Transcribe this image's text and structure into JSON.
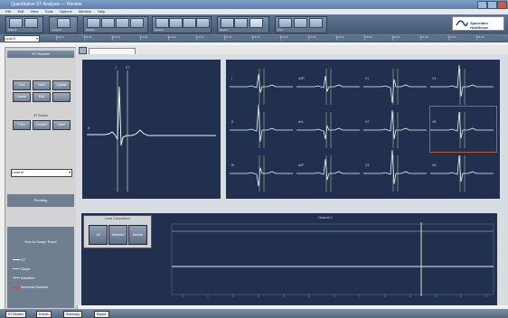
{
  "window": {
    "title": "Quantitative ST Analysis — Review"
  },
  "menu": [
    "File",
    "Edit",
    "View",
    "Tools",
    "Options",
    "Window",
    "Help"
  ],
  "toolbar_groups": [
    "Patient",
    "Analysis",
    "Display",
    "Review",
    "Report",
    "Print"
  ],
  "logo_text": "Spacelabs Healthcare",
  "lead_select": "Lead II",
  "timeline_ticks": [
    "08:00",
    "09:00",
    "10:00",
    "11:00",
    "12:00",
    "13:00",
    "14:00",
    "15:00",
    "16:00",
    "17:00",
    "18:00",
    "19:00",
    "20:00",
    "21:00",
    "22:00",
    "23:00"
  ],
  "sidebar": {
    "header": "ST Review",
    "row1": [
      "Prev",
      "Next",
      "Update"
    ],
    "row2": [
      "Delete",
      "Edit",
      ""
    ],
    "event_label": "ST Events",
    "row3": [
      "Prev",
      "Current",
      "Next"
    ],
    "select": "Lead III",
    "status": "Pending",
    "legend_title": "Key to Graph Trend",
    "legend": [
      {
        "label": "ST",
        "color": "#ffffff"
      },
      {
        "label": "Slope",
        "color": "#d9d9d9"
      },
      {
        "label": "Baseline",
        "color": "#bfe3ff"
      },
      {
        "label": "Ischemic Burden",
        "color": "#e04a3a"
      }
    ]
  },
  "median": {
    "lead": "II",
    "markers": [
      "J",
      "ST"
    ]
  },
  "leads": [
    "I",
    "aVR",
    "V1",
    "V4",
    "II",
    "aVL",
    "V2",
    "V5",
    "III",
    "aVF",
    "V3",
    "V6"
  ],
  "compare_box": {
    "title": "Lead Comparison",
    "buttons": [
      "All",
      "Selected",
      "Normal"
    ]
  },
  "trend": {
    "title": "Channel 1"
  },
  "status_tabs": [
    "ST Review",
    "Events",
    "Summary",
    "Report"
  ],
  "colors": {
    "panel": "#20304e",
    "trace": "#e8eef6",
    "highlight": "#c05a2a"
  }
}
